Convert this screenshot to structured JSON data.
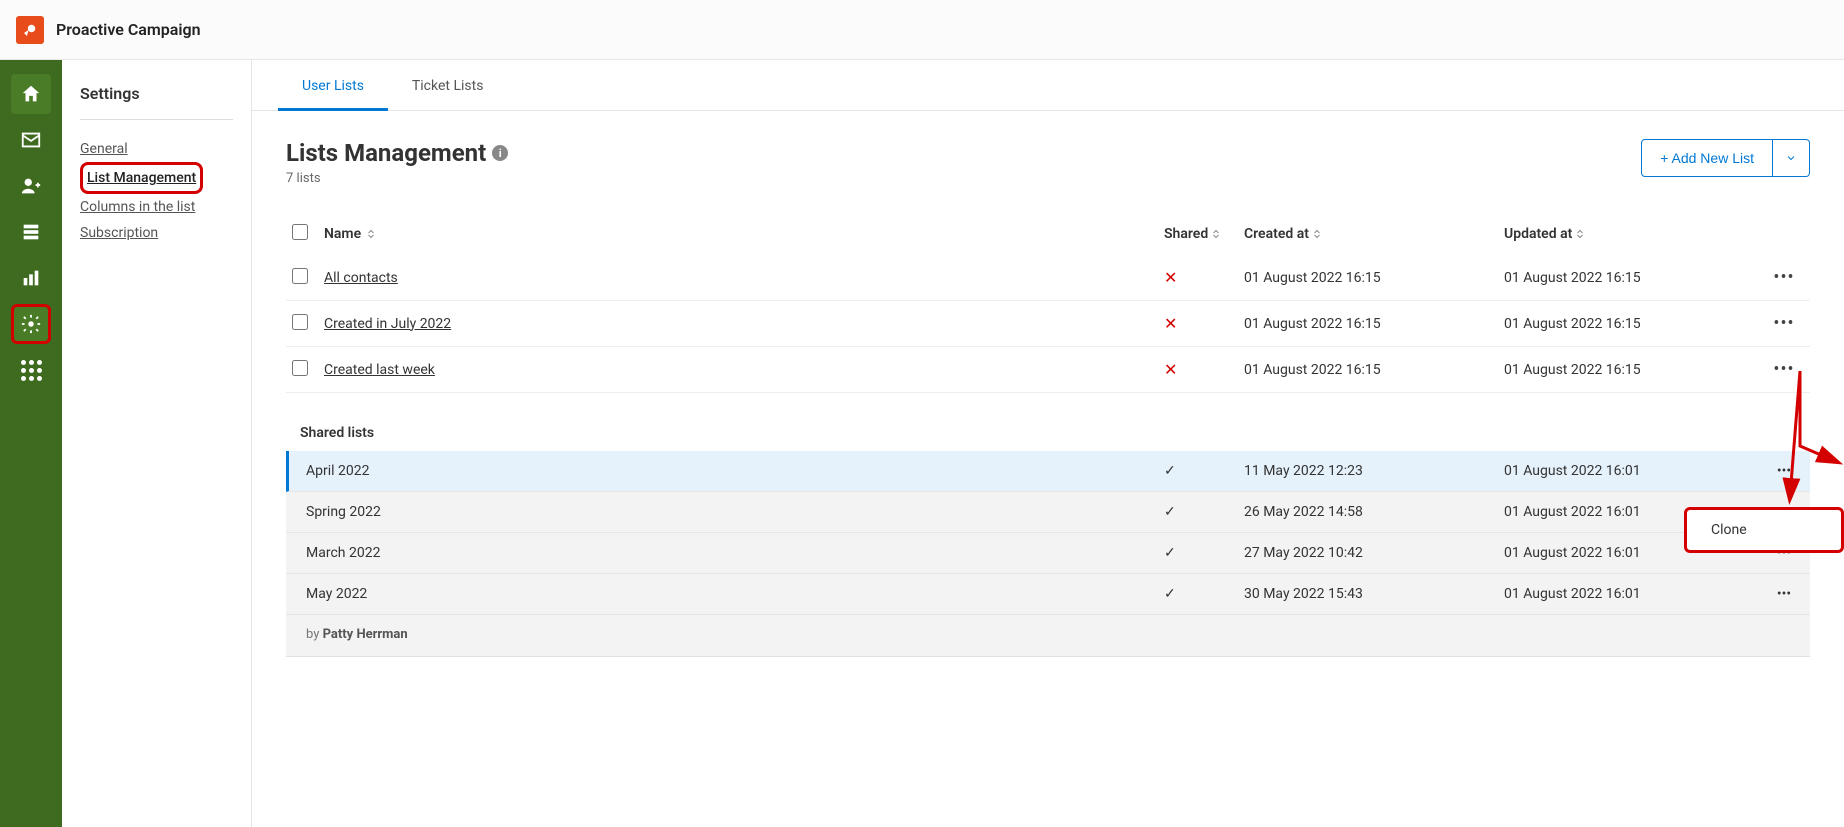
{
  "app_title": "Proactive Campaign",
  "sidebar": {
    "heading": "Settings",
    "items": [
      {
        "label": "General"
      },
      {
        "label": "List Management"
      },
      {
        "label": "Columns in the list"
      },
      {
        "label": "Subscription"
      }
    ]
  },
  "tabs": [
    {
      "label": "User Lists",
      "active": true
    },
    {
      "label": "Ticket Lists",
      "active": false
    }
  ],
  "page": {
    "title": "Lists Management",
    "count_text": "7 lists",
    "add_button": "+ Add New List"
  },
  "columns": {
    "name": "Name",
    "shared": "Shared",
    "created": "Created at",
    "updated": "Updated at"
  },
  "rows": [
    {
      "name": "All contacts",
      "shared": false,
      "created": "01 August 2022 16:15",
      "updated": "01 August 2022 16:15"
    },
    {
      "name": "Created in July 2022",
      "shared": false,
      "created": "01 August 2022 16:15",
      "updated": "01 August 2022 16:15"
    },
    {
      "name": "Created last week",
      "shared": false,
      "created": "01 August 2022 16:15",
      "updated": "01 August 2022 16:15"
    }
  ],
  "shared_section_title": "Shared lists",
  "shared_rows": [
    {
      "name": "April 2022",
      "shared": true,
      "created": "11 May 2022 12:23",
      "updated": "01 August 2022 16:01",
      "selected": true
    },
    {
      "name": "Spring 2022",
      "shared": true,
      "created": "26 May 2022 14:58",
      "updated": "01 August 2022 16:01"
    },
    {
      "name": "March 2022",
      "shared": true,
      "created": "27 May 2022 10:42",
      "updated": "01 August 2022 16:01"
    },
    {
      "name": "May 2022",
      "shared": true,
      "created": "30 May 2022 15:43",
      "updated": "01 August 2022 16:01"
    }
  ],
  "byline_prefix": "by ",
  "byline_author": "Patty Herrman",
  "menu": {
    "clone": "Clone"
  }
}
